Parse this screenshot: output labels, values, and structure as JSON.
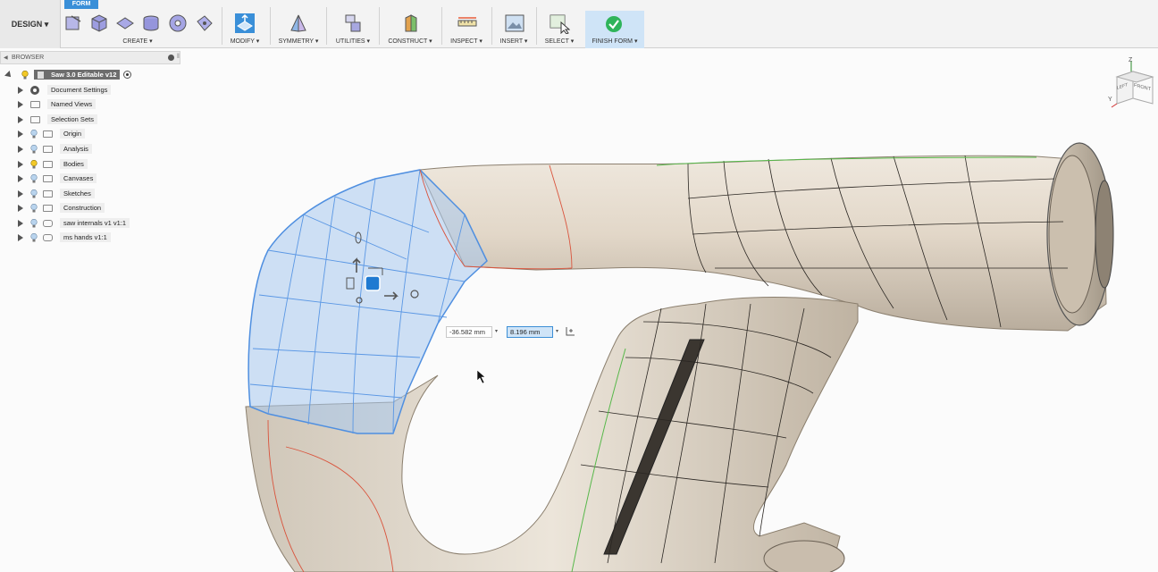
{
  "workspace_button": "DESIGN ▾",
  "form_tab": "FORM",
  "toolbar": {
    "create": "CREATE ▾",
    "modify": "MODIFY ▾",
    "symmetry": "SYMMETRY ▾",
    "utilities": "UTILITIES ▾",
    "construct": "CONSTRUCT ▾",
    "inspect": "INSPECT ▾",
    "insert": "INSERT ▾",
    "select": "SELECT ▾",
    "finish_form": "FINISH FORM ▾"
  },
  "browser": {
    "title": "BROWSER",
    "root": "Saw 3.0 Editable v12",
    "items": [
      {
        "label": "Document Settings",
        "icon": "gear-icon"
      },
      {
        "label": "Named Views",
        "icon": "folder-icon"
      },
      {
        "label": "Selection Sets",
        "icon": "folder-icon"
      },
      {
        "label": "Origin",
        "icon": "folder-icon"
      },
      {
        "label": "Analysis",
        "icon": "folder-icon"
      },
      {
        "label": "Bodies",
        "icon": "folder-icon"
      },
      {
        "label": "Canvases",
        "icon": "folder-icon"
      },
      {
        "label": "Sketches",
        "icon": "folder-icon"
      },
      {
        "label": "Construction",
        "icon": "folder-icon"
      },
      {
        "label": "saw internals v1 v1:1",
        "icon": "component-icon"
      },
      {
        "label": "ms hands v1:1",
        "icon": "component-icon"
      }
    ]
  },
  "viewcube": {
    "left_face": "LEFT",
    "front_face": "FRONT",
    "axis_z": "Z",
    "axis_y": "Y",
    "axis_x": "X"
  },
  "dimensions": {
    "field1": "-36.582 mm",
    "field2": "8.196 mm"
  },
  "colors": {
    "accent": "#3a8fd8",
    "finish_green": "#2fb45a",
    "surface": "#e7ddd0",
    "selection": "#6aa7e8"
  }
}
